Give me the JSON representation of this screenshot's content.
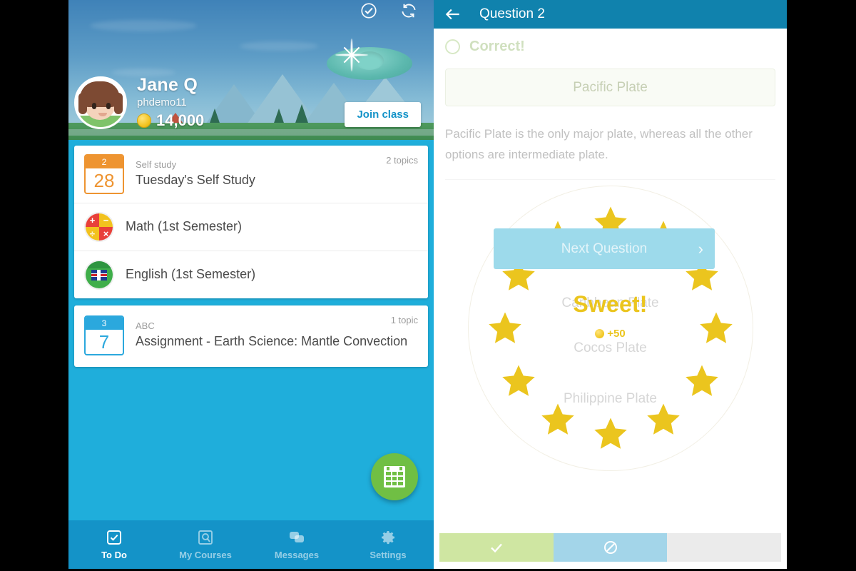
{
  "left_app": {
    "hero": {
      "icons": [
        "check-circle-icon",
        "sync-icon"
      ],
      "user_name": "Jane Q",
      "username": "phdemo11",
      "coins": "14,000",
      "join_button": "Join class"
    },
    "cards": [
      {
        "items": [
          {
            "type": "calendar-event",
            "cal_month": "2",
            "cal_day": "28",
            "cal_color": "#EE9431",
            "subtitle": "Self study",
            "title": "Tuesday's Self Study",
            "count": "2 topics"
          },
          {
            "type": "subject",
            "icon": "math-icon",
            "title": "Math (1st Semester)"
          },
          {
            "type": "subject",
            "icon": "english-flag-icon",
            "title": "English (1st Semester)"
          }
        ]
      },
      {
        "items": [
          {
            "type": "calendar-event",
            "cal_month": "3",
            "cal_day": "7",
            "cal_color": "#2BA8DD",
            "subtitle": "ABC",
            "title": "Assignment - Earth Science: Mantle Convection",
            "count": "1 topic"
          }
        ]
      }
    ],
    "fab": {
      "icon": "calendar-icon"
    },
    "tabbar": [
      {
        "label": "To Do",
        "icon": "checkbox-icon",
        "active": true
      },
      {
        "label": "My Courses",
        "icon": "courses-icon",
        "active": false
      },
      {
        "label": "Messages",
        "icon": "messages-icon",
        "active": false
      },
      {
        "label": "Settings",
        "icon": "gear-icon",
        "active": false
      }
    ]
  },
  "right_app": {
    "header": {
      "back_icon": "back-arrow-icon",
      "title": "Question 2"
    },
    "feedback": {
      "status": "Correct!",
      "status_color": "#7aa84b"
    },
    "selected_answer": "Pacific Plate",
    "explanation": "Pacific Plate is the only major plate, whereas all the other options are intermediate plate.",
    "next_button": {
      "label": "Next Question",
      "chevron": "chevron-right-icon"
    },
    "other_options": [
      "Caribbean Plate",
      "Cocos Plate",
      "Philippine Plate"
    ],
    "reward": {
      "title": "Sweet!",
      "points": "+50",
      "coin_icon": "coin-icon",
      "star_count": 12,
      "star_color": "#EBC51E"
    },
    "progress": [
      {
        "state": "done",
        "icon": "check-icon",
        "color": "#cfe6a2"
      },
      {
        "state": "current",
        "icon": "target-icon",
        "color": "#a3d5e9"
      },
      {
        "state": "todo",
        "icon": "",
        "color": "#ebebeb"
      }
    ]
  }
}
